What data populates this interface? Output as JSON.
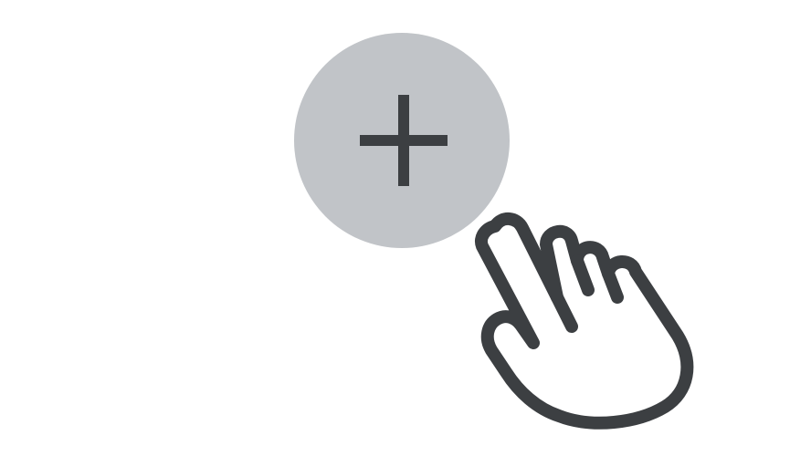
{
  "add_button": {
    "icon": "plus-icon",
    "background_color": "#c1c4c8",
    "icon_color": "#3c3f42"
  },
  "cursor": {
    "icon": "hand-pointer-icon",
    "stroke_color": "#3c3f42",
    "fill_color": "#ffffff"
  }
}
